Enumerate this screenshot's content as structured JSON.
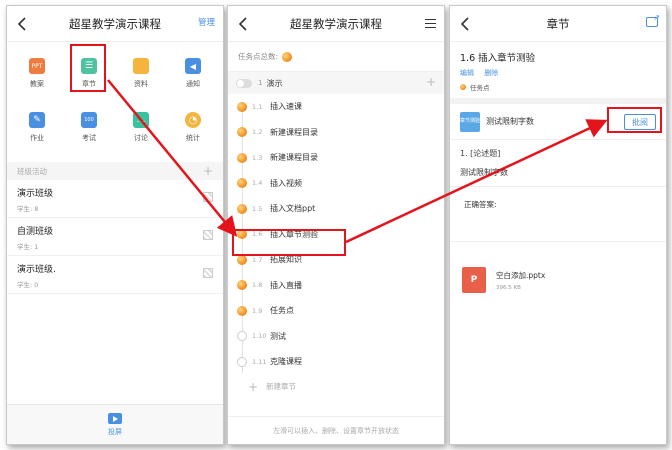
{
  "screen1": {
    "title": "超星教学演示课程",
    "manage": "管理",
    "grid": [
      {
        "label": "教案",
        "icon": "ppt-icon",
        "color": "#f07b3f",
        "glyph": "PPT"
      },
      {
        "label": "章节",
        "icon": "chapter-list-icon",
        "color": "#4fc3a1",
        "glyph": "☰"
      },
      {
        "label": "资料",
        "icon": "folder-icon",
        "color": "#f5b53d",
        "glyph": ""
      },
      {
        "label": "通知",
        "icon": "speaker-icon",
        "color": "#4a90e2",
        "glyph": "◀"
      },
      {
        "label": "作业",
        "icon": "homework-icon",
        "color": "#4a90e2",
        "glyph": "✎"
      },
      {
        "label": "考试",
        "icon": "exam-icon",
        "color": "#4a90e2",
        "glyph": "100"
      },
      {
        "label": "讨论",
        "icon": "discussion-icon",
        "color": "#38c2a0",
        "glyph": "…"
      },
      {
        "label": "统计",
        "icon": "pie-chart-icon",
        "color": "#f5b53d",
        "glyph": "◔"
      }
    ],
    "section_label": "班级活动",
    "classes": [
      {
        "name": "演示班级",
        "students": "学生: 8"
      },
      {
        "name": "自测班级",
        "students": "学生: 1"
      },
      {
        "name": "演示班级.",
        "students": "学生: 0"
      }
    ],
    "bottom_label": "投屏"
  },
  "screen2": {
    "title": "超星教学演示课程",
    "task_total_label": "任务点总数:",
    "chapter_number": "1",
    "chapter_name": "演示",
    "sections": [
      {
        "num": "1.1",
        "name": "插入速课",
        "task": true
      },
      {
        "num": "1.2",
        "name": "新建课程目录",
        "task": true
      },
      {
        "num": "1.3",
        "name": "新建课程目录",
        "task": true
      },
      {
        "num": "1.4",
        "name": "插入视频",
        "task": true
      },
      {
        "num": "1.5",
        "name": "插入文档ppt",
        "task": true
      },
      {
        "num": "1.6",
        "name": "插入章节测验",
        "task": true
      },
      {
        "num": "1.7",
        "name": "拓展知识",
        "task": true
      },
      {
        "num": "1.8",
        "name": "插入直播",
        "task": true
      },
      {
        "num": "1.9",
        "name": "任务点",
        "task": true
      },
      {
        "num": "1.10",
        "name": "测试",
        "task": false
      },
      {
        "num": "1.11",
        "name": "克隆课程",
        "task": false
      }
    ],
    "add_section": "新建章节",
    "hint": "左滑可以插入、删除、设置章节开放状态"
  },
  "screen3": {
    "title": "章节",
    "section_title": "1.6 插入章节测验",
    "edit": "编辑",
    "delete": "删除",
    "task_point": "任务点",
    "quiz_icon_text": "章节测验",
    "quiz_name": "测试限制字数",
    "grade_button": "批阅",
    "question_type": "1. [论述题]",
    "question_body": "测试限制字数",
    "answer_label": "正确答案:",
    "file_name": "空白添加.pptx",
    "file_size": "396.5 KB",
    "file_icon_text": "P"
  },
  "colors": {
    "highlight": "#e3141b",
    "accent": "#4a90e2",
    "task_dot": "#f0952a"
  }
}
